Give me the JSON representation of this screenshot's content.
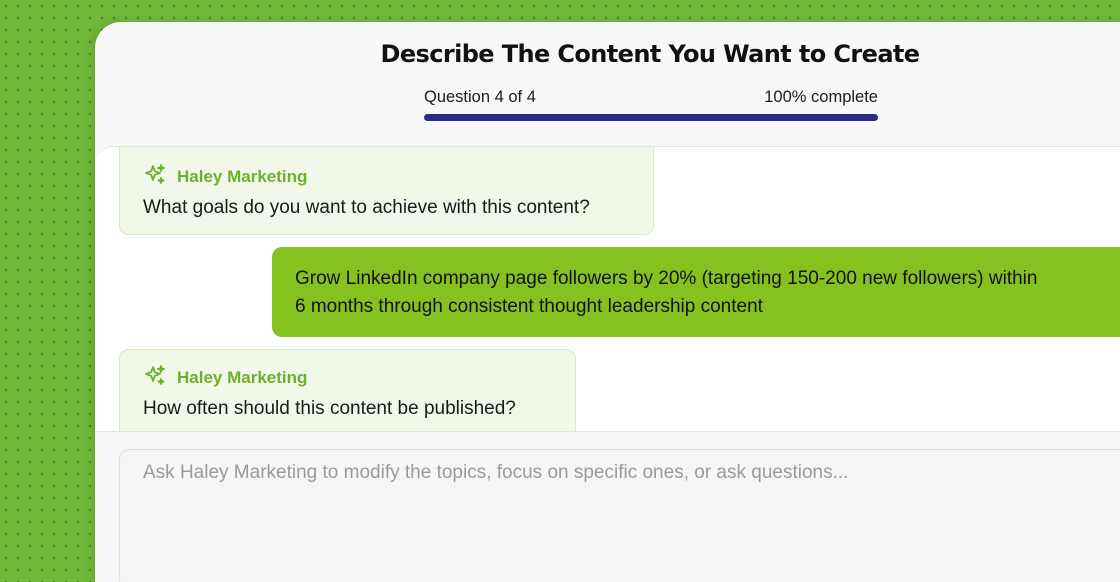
{
  "header": {
    "title": "Describe The Content You Want to Create",
    "progress_label": "Question 4 of 4",
    "progress_status": "100% complete",
    "progress_fraction": 1.0
  },
  "messages": [
    {
      "role": "assistant",
      "sender": "Haley Marketing",
      "icon": "sparkles-icon",
      "text": "What goals do you want to achieve with this content?"
    },
    {
      "role": "user",
      "line1": "Grow LinkedIn company page followers by 20% (targeting 150-200 new followers) within",
      "line2": "6 months through consistent thought leadership content"
    },
    {
      "role": "assistant",
      "sender": "Haley Marketing",
      "icon": "sparkles-icon",
      "text": "How often should this content be published?"
    }
  ],
  "composer": {
    "placeholder": "Ask Haley Marketing to modify the topics, focus on specific ones, or ask questions..."
  },
  "colors": {
    "background": "#72b83a",
    "accent_green": "#86c21f",
    "progress": "#2b2a86",
    "sender": "#6fb02a"
  }
}
